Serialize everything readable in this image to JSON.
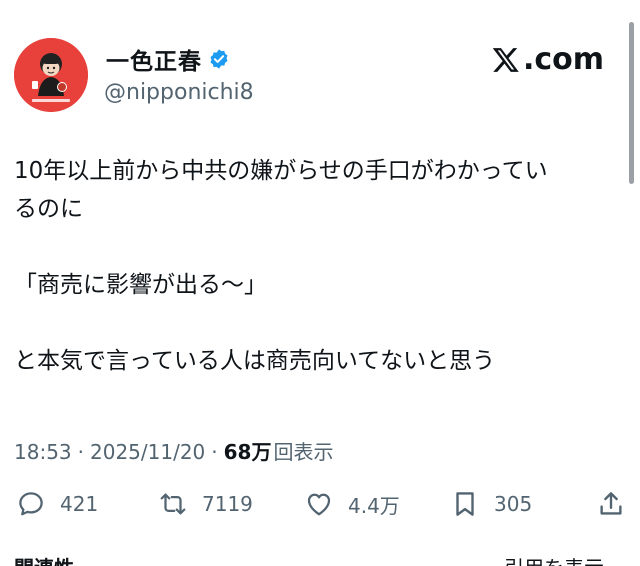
{
  "author": {
    "display_name": "一色正春",
    "handle": "@nipponichi8",
    "verified": true,
    "avatar_caption": "masa-chan's"
  },
  "brand": {
    "label": ".com",
    "icon": "x-logo-icon"
  },
  "tweet": {
    "paragraphs": [
      "10年以上前から中共の嫌がらせの手口がわかってい",
      "るのに",
      "",
      "「商売に影響が出る〜」",
      "",
      "と本気で言っている人は商売向いてないと思う"
    ]
  },
  "meta": {
    "time": "18:53",
    "separator": "·",
    "date": "2025/11/20",
    "views_count": "68万",
    "views_label": "回表示"
  },
  "actions": {
    "reply": {
      "icon": "reply-icon",
      "count": "421"
    },
    "retweet": {
      "icon": "retweet-icon",
      "count": "7119"
    },
    "like": {
      "icon": "heart-icon",
      "count": "4.4万"
    },
    "bookmark": {
      "icon": "bookmark-icon",
      "count": "305"
    },
    "share": {
      "icon": "share-icon"
    }
  },
  "footer": {
    "related_label": "関連性",
    "quotes_label": "引用を表示"
  },
  "colors": {
    "text": "#0f1419",
    "secondary": "#536471",
    "verified_blue": "#1d9bf0",
    "avatar_red": "#e8413c"
  }
}
